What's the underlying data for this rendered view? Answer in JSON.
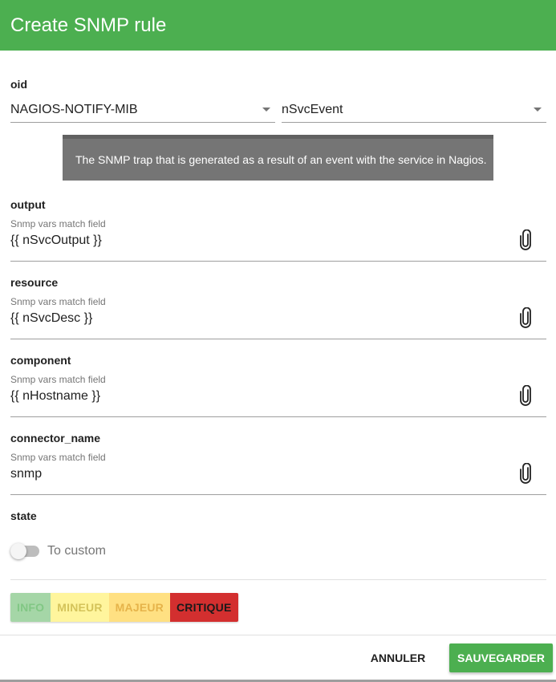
{
  "dialog": {
    "title": "Create SNMP rule"
  },
  "oid": {
    "label": "oid",
    "mib_value": "NAGIOS-NOTIFY-MIB",
    "object_value": "nSvcEvent",
    "description": "The SNMP trap that is generated as a result of an event with the service in Nagios."
  },
  "fields": [
    {
      "label": "output",
      "hint": "Snmp vars match field",
      "value": "{{ nSvcOutput }}",
      "icon": "paperclip-icon"
    },
    {
      "label": "resource",
      "hint": "Snmp vars match field",
      "value": "{{ nSvcDesc }}",
      "icon": "paperclip-icon"
    },
    {
      "label": "component",
      "hint": "Snmp vars match field",
      "value": "{{ nHostname }}",
      "icon": "paperclip-icon"
    },
    {
      "label": "connector_name",
      "hint": "Snmp vars match field",
      "value": "snmp",
      "icon": "paperclip-icon"
    }
  ],
  "state": {
    "label": "state",
    "toggle_label": "To custom",
    "toggle_on": false,
    "buttons": [
      {
        "label": "INFO",
        "bg": "#a5d6a7",
        "color": "#81c784"
      },
      {
        "label": "MINEUR",
        "bg": "#fff59d",
        "color": "#d4c35a"
      },
      {
        "label": "MAJEUR",
        "bg": "#ffe082",
        "color": "#e6b34a"
      },
      {
        "label": "CRITIQUE",
        "bg": "#d32f2f",
        "color": "#1a1a1a"
      }
    ]
  },
  "actions": {
    "cancel_label": "ANNULER",
    "save_label": "SAUVEGARDER"
  },
  "colors": {
    "accent": "#4caf50",
    "tooltip_bg": "#757575"
  }
}
